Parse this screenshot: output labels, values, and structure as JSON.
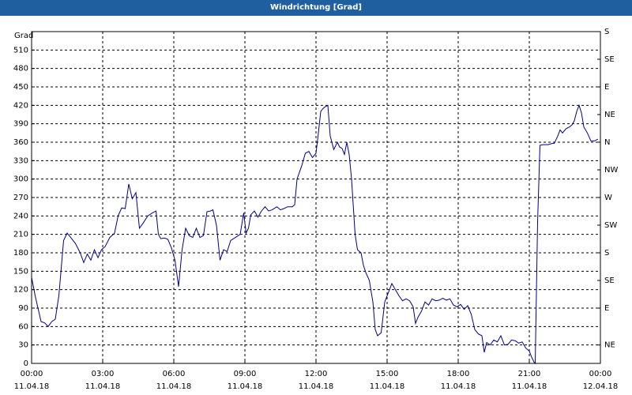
{
  "window": {
    "title": "Windrichtung [Grad]"
  },
  "chart_data": {
    "type": "line",
    "title": "Windrichtung [Grad]",
    "ylabel": "Grad",
    "ylim": [
      0,
      540
    ],
    "xlim": [
      "11.04.18 00:00",
      "12.04.18 00:00"
    ],
    "grid": true,
    "y_ticks": [
      0,
      30,
      60,
      90,
      120,
      150,
      180,
      210,
      240,
      270,
      300,
      330,
      360,
      390,
      420,
      450,
      480,
      510
    ],
    "right_ticks": [
      {
        "value": 30,
        "label": "NE"
      },
      {
        "value": 90,
        "label": "E"
      },
      {
        "value": 135,
        "label": "SE"
      },
      {
        "value": 180,
        "label": "S"
      },
      {
        "value": 225,
        "label": "SW"
      },
      {
        "value": 270,
        "label": "W"
      },
      {
        "value": 315,
        "label": "NW"
      },
      {
        "value": 360,
        "label": "N"
      },
      {
        "value": 405,
        "label": "NE"
      },
      {
        "value": 450,
        "label": "E"
      },
      {
        "value": 495,
        "label": "SE"
      },
      {
        "value": 540,
        "label": "S"
      }
    ],
    "x_ticks": [
      {
        "hour": 0,
        "time": "00:00",
        "date": "11.04.18"
      },
      {
        "hour": 3,
        "time": "03:00",
        "date": "11.04.18"
      },
      {
        "hour": 6,
        "time": "06:00",
        "date": "11.04.18"
      },
      {
        "hour": 9,
        "time": "09:00",
        "date": "11.04.18"
      },
      {
        "hour": 12,
        "time": "12:00",
        "date": "11.04.18"
      },
      {
        "hour": 15,
        "time": "15:00",
        "date": "11.04.18"
      },
      {
        "hour": 18,
        "time": "18:00",
        "date": "11.04.18"
      },
      {
        "hour": 21,
        "time": "21:00",
        "date": "11.04.18"
      },
      {
        "hour": 24,
        "time": "00:00",
        "date": "12.04.18"
      }
    ],
    "series": [
      {
        "color": "#00008b",
        "points": [
          [
            0.0,
            140
          ],
          [
            0.15,
            110
          ],
          [
            0.4,
            68
          ],
          [
            0.55,
            66
          ],
          [
            0.7,
            60
          ],
          [
            0.85,
            68
          ],
          [
            1.0,
            72
          ],
          [
            1.15,
            110
          ],
          [
            1.35,
            200
          ],
          [
            1.5,
            212
          ],
          [
            1.65,
            205
          ],
          [
            1.85,
            195
          ],
          [
            2.05,
            180
          ],
          [
            2.2,
            164
          ],
          [
            2.35,
            178
          ],
          [
            2.5,
            168
          ],
          [
            2.65,
            185
          ],
          [
            2.8,
            172
          ],
          [
            2.95,
            185
          ],
          [
            3.1,
            190
          ],
          [
            3.3,
            205
          ],
          [
            3.5,
            212
          ],
          [
            3.65,
            240
          ],
          [
            3.8,
            253
          ],
          [
            3.95,
            252
          ],
          [
            4.1,
            292
          ],
          [
            4.25,
            268
          ],
          [
            4.4,
            278
          ],
          [
            4.55,
            220
          ],
          [
            4.7,
            228
          ],
          [
            4.9,
            240
          ],
          [
            5.1,
            245
          ],
          [
            5.25,
            248
          ],
          [
            5.35,
            210
          ],
          [
            5.45,
            203
          ],
          [
            5.6,
            204
          ],
          [
            5.75,
            202
          ],
          [
            5.9,
            188
          ],
          [
            6.05,
            168
          ],
          [
            6.2,
            125
          ],
          [
            6.35,
            185
          ],
          [
            6.5,
            220
          ],
          [
            6.65,
            208
          ],
          [
            6.8,
            205
          ],
          [
            6.95,
            220
          ],
          [
            7.1,
            205
          ],
          [
            7.25,
            208
          ],
          [
            7.4,
            247
          ],
          [
            7.55,
            248
          ],
          [
            7.65,
            250
          ],
          [
            7.8,
            225
          ],
          [
            7.95,
            168
          ],
          [
            8.1,
            185
          ],
          [
            8.25,
            182
          ],
          [
            8.4,
            200
          ],
          [
            8.6,
            205
          ],
          [
            8.8,
            210
          ],
          [
            8.95,
            245
          ],
          [
            9.05,
            212
          ],
          [
            9.15,
            220
          ],
          [
            9.25,
            242
          ],
          [
            9.4,
            248
          ],
          [
            9.55,
            238
          ],
          [
            9.7,
            248
          ],
          [
            9.85,
            255
          ],
          [
            10.0,
            248
          ],
          [
            10.15,
            250
          ],
          [
            10.35,
            255
          ],
          [
            10.5,
            250
          ],
          [
            10.65,
            252
          ],
          [
            10.8,
            255
          ],
          [
            11.0,
            255
          ],
          [
            11.1,
            258
          ],
          [
            11.2,
            300
          ],
          [
            11.4,
            322
          ],
          [
            11.55,
            342
          ],
          [
            11.7,
            345
          ],
          [
            11.85,
            335
          ],
          [
            12.0,
            342
          ],
          [
            12.1,
            375
          ],
          [
            12.2,
            410
          ],
          [
            12.3,
            415
          ],
          [
            12.4,
            418
          ],
          [
            12.5,
            420
          ],
          [
            12.6,
            370
          ],
          [
            12.75,
            348
          ],
          [
            12.9,
            360
          ],
          [
            13.0,
            352
          ],
          [
            13.1,
            350
          ],
          [
            13.2,
            340
          ],
          [
            13.3,
            360
          ],
          [
            13.4,
            340
          ],
          [
            13.5,
            300
          ],
          [
            13.65,
            210
          ],
          [
            13.75,
            185
          ],
          [
            13.9,
            180
          ],
          [
            14.0,
            160
          ],
          [
            14.1,
            148
          ],
          [
            14.25,
            135
          ],
          [
            14.4,
            100
          ],
          [
            14.5,
            55
          ],
          [
            14.6,
            45
          ],
          [
            14.75,
            50
          ],
          [
            14.9,
            100
          ],
          [
            15.05,
            115
          ],
          [
            15.2,
            130
          ],
          [
            15.35,
            120
          ],
          [
            15.5,
            110
          ],
          [
            15.65,
            102
          ],
          [
            15.8,
            105
          ],
          [
            15.95,
            102
          ],
          [
            16.1,
            92
          ],
          [
            16.2,
            65
          ],
          [
            16.3,
            75
          ],
          [
            16.45,
            85
          ],
          [
            16.6,
            100
          ],
          [
            16.75,
            95
          ],
          [
            16.9,
            105
          ],
          [
            17.05,
            102
          ],
          [
            17.2,
            103
          ],
          [
            17.35,
            106
          ],
          [
            17.5,
            103
          ],
          [
            17.65,
            105
          ],
          [
            17.8,
            95
          ],
          [
            17.95,
            92
          ],
          [
            18.1,
            96
          ],
          [
            18.25,
            88
          ],
          [
            18.4,
            94
          ],
          [
            18.55,
            80
          ],
          [
            18.7,
            55
          ],
          [
            18.85,
            48
          ],
          [
            19.0,
            45
          ],
          [
            19.1,
            18
          ],
          [
            19.2,
            34
          ],
          [
            19.35,
            30
          ],
          [
            19.5,
            38
          ],
          [
            19.65,
            35
          ],
          [
            19.8,
            45
          ],
          [
            19.95,
            30
          ],
          [
            20.1,
            31
          ],
          [
            20.25,
            38
          ],
          [
            20.4,
            37
          ],
          [
            20.55,
            33
          ],
          [
            20.7,
            35
          ],
          [
            20.85,
            25
          ],
          [
            21.0,
            20
          ],
          [
            21.1,
            10
          ],
          [
            21.2,
            2
          ],
          [
            21.25,
            0
          ],
          [
            21.35,
            230
          ],
          [
            21.45,
            355
          ],
          [
            21.6,
            356
          ],
          [
            21.8,
            356
          ],
          [
            21.95,
            358
          ],
          [
            22.05,
            358
          ],
          [
            22.2,
            370
          ],
          [
            22.3,
            380
          ],
          [
            22.4,
            375
          ],
          [
            22.55,
            382
          ],
          [
            22.7,
            385
          ],
          [
            22.8,
            388
          ],
          [
            22.9,
            395
          ],
          [
            23.0,
            410
          ],
          [
            23.1,
            420
          ],
          [
            23.2,
            408
          ],
          [
            23.3,
            385
          ],
          [
            23.45,
            375
          ],
          [
            23.6,
            362
          ],
          [
            23.75,
            362
          ],
          [
            23.9,
            365
          ]
        ]
      }
    ]
  }
}
